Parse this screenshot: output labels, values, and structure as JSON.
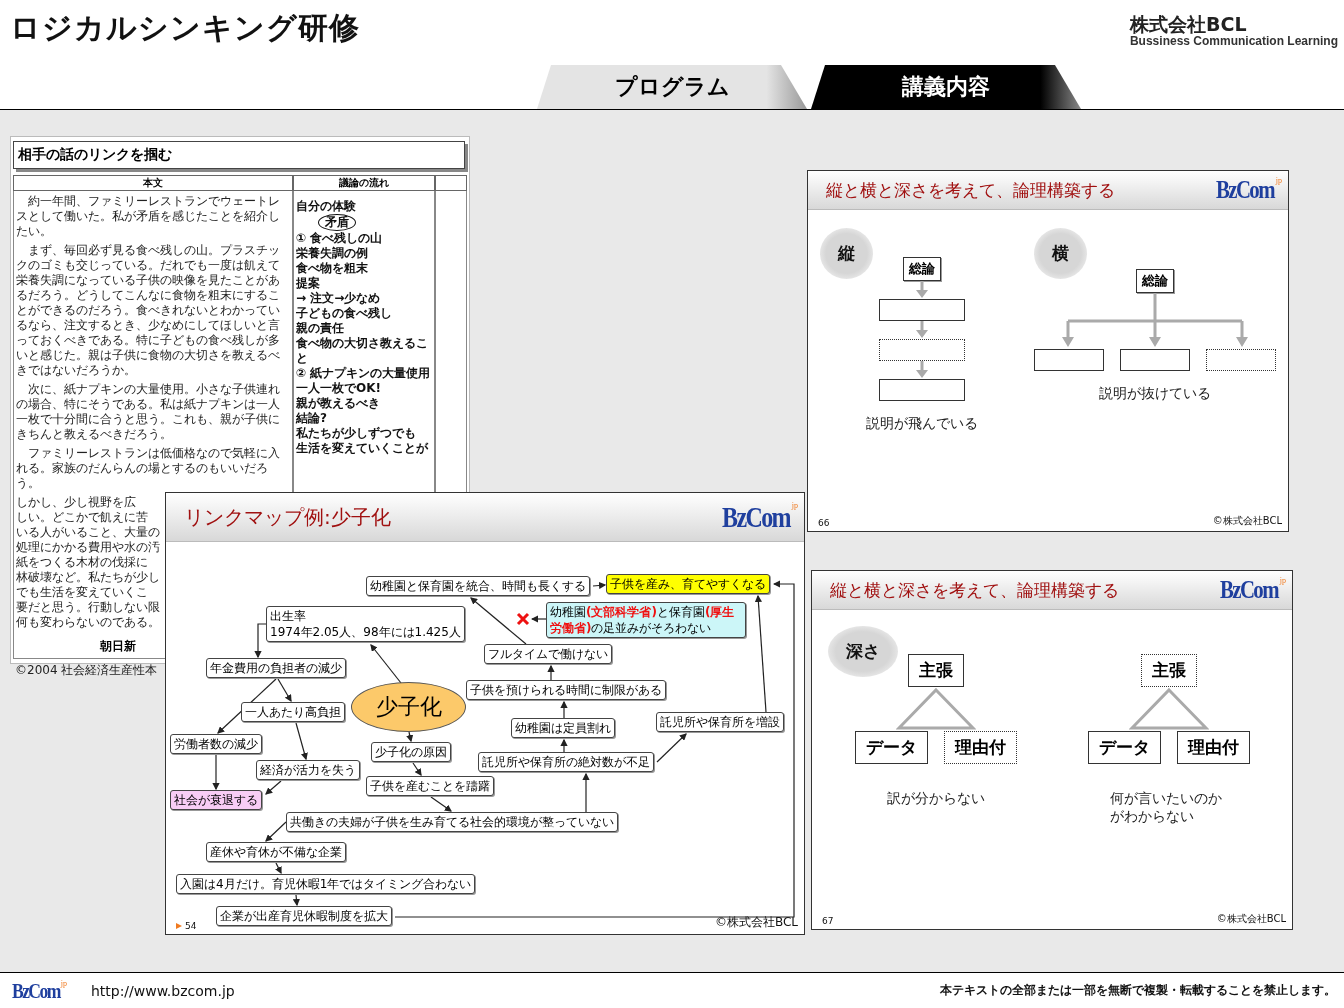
{
  "header": {
    "title": "ロジカルシンキング研修",
    "company": "株式会社BCL",
    "company_tagline": "Bussiness Communication Learning"
  },
  "tabs": [
    {
      "label": "プログラム",
      "selected": false
    },
    {
      "label": "講義内容",
      "selected": true
    }
  ],
  "document": {
    "title": "相手の話のリンクを掴む",
    "columns": [
      "本文",
      "議論の流れ"
    ],
    "body": [
      "約一年間、ファミリーレストランでウェートレスとして働いた。私が矛盾を感じたことを紹介したい。",
      "まず、毎回必ず見る食べ残しの山。プラスチックのゴミも交じっている。だれでも一度は飢えて栄養失調になっている子供の映像を見たことがあるだろう。どうしてこんなに食物を粗末にすることができるのだろう。食べきれないとわかっているなら、注文するとき、少なめにしてほしいと言っておくべきである。特に子どもの食べ残しが多いと感じた。親は子供に食物の大切さを教えるべきではないだろうか。",
      "次に、紙ナプキンの大量使用。小さな子供連れの場合、特にそうである。私は紙ナプキンは一人一枚で十分間に合うと思う。これも、親が子供にきちんと教えるべきだろう。",
      "ファミリーレストランは低価格なので気軽に入れる。家族のだんらんの場とするのもいいだろう。"
    ],
    "cut_lines": [
      "しかし、少し視野を広",
      "しい。どこかで飢えに苦",
      "いる人がいること、大量の",
      "処理にかかる費用や水の汚",
      "紙をつくる木材の伐採に",
      "林破壊など。私たちが少し",
      "でも生活を変えていくこ",
      "要だと思う。行動しない限",
      "何も変わらないのである。"
    ],
    "source": "朝日新",
    "notes": [
      {
        "text": "自分の体験",
        "kind": "plain"
      },
      {
        "text": "矛盾",
        "kind": "circled"
      },
      {
        "text": "① 食べ残しの山",
        "kind": "plain"
      },
      {
        "text": "栄養失調の例",
        "kind": "plain"
      },
      {
        "text": "食べ物を粗末",
        "kind": "plain"
      },
      {
        "text": "提案",
        "kind": "plain"
      },
      {
        "text": "→ 注文→少なめ",
        "kind": "plain"
      },
      {
        "text": "子どもの食べ残し",
        "kind": "plain"
      },
      {
        "text": "親の責任",
        "kind": "plain"
      },
      {
        "text": "食べ物の大切さ教えること",
        "kind": "plain"
      },
      {
        "text": "② 紙ナプキンの大量使用",
        "kind": "plain"
      },
      {
        "text": "一人一枚でOK!",
        "kind": "plain"
      },
      {
        "text": "親が教えるべき",
        "kind": "plain"
      },
      {
        "text": "結論?",
        "kind": "plain"
      },
      {
        "text": "私たちが少しずつでも",
        "kind": "plain"
      },
      {
        "text": "生活を変えていくことが",
        "kind": "plain"
      }
    ],
    "footer": "©2004 社会経済生産性本"
  },
  "link_map": {
    "title": "リンクマップ例:少子化",
    "logo": "BzCom",
    "logo_suffix": "jp",
    "page": "54",
    "copyright": "©株式会社BCL",
    "nodes": [
      {
        "text": "幼稚園と保育園を統合、時間も長くする",
        "kind": "box",
        "color": "#ffffff"
      },
      {
        "text": "子供を産み、育てやすくなる",
        "kind": "box",
        "color": "#ffff00"
      },
      {
        "text": "幼稚園**(文部科学省)**と保育園**(厚生労働省)**の足並みがそろわない",
        "kind": "box",
        "color": "#ccf6f8"
      },
      {
        "kind": "cross"
      },
      {
        "text": "フルタイムで働けない",
        "kind": "box",
        "color": "#ffffff"
      },
      {
        "text": "子供を預けられる時間に制限がある",
        "kind": "box",
        "color": "#ffffff"
      },
      {
        "text": "託児所や保育所を増設",
        "kind": "box",
        "color": "#ffffff"
      },
      {
        "text": "幼稚園は定員割れ",
        "kind": "box",
        "color": "#ffffff"
      },
      {
        "text": "託児所や保育所の絶対数が不足",
        "kind": "box",
        "color": "#ffffff"
      },
      {
        "heading": "出生率",
        "text": "1974年2.05人、98年には1.425人",
        "kind": "titled",
        "color": "#ffffff"
      },
      {
        "text": "少子化",
        "kind": "ellipse",
        "color": "#fcc96a"
      },
      {
        "text": "年金費用の負担者の減少",
        "kind": "box",
        "color": "#ffffff"
      },
      {
        "text": "一人あたり高負担",
        "kind": "box",
        "color": "#ffffff"
      },
      {
        "text": "労働者数の減少",
        "kind": "box",
        "color": "#ffffff"
      },
      {
        "text": "経済が活力を失う",
        "kind": "box",
        "color": "#ffffff"
      },
      {
        "text": "社会が衰退する",
        "kind": "box",
        "color": "#f8cdf5"
      },
      {
        "text": "少子化の原因",
        "kind": "box",
        "color": "#ffffff"
      },
      {
        "text": "子供を産むことを躊躇",
        "kind": "box",
        "color": "#ffffff"
      },
      {
        "text": "共働きの夫婦が子供を生み育てる社会的環境が整っていない",
        "kind": "box",
        "color": "#ffffff"
      },
      {
        "text": "産休や育休が不備な企業",
        "kind": "box",
        "color": "#ffffff"
      },
      {
        "text": "入園は4月だけ。育児休暇1年ではタイミング合わない",
        "kind": "box",
        "color": "#ffffff"
      },
      {
        "text": "企業が出産育児休暇制度を拡大",
        "kind": "box",
        "color": "#ffffff"
      }
    ]
  },
  "slides": [
    {
      "title": "縦と横と深さを考えて、論理構築する",
      "logo": "BzCom",
      "logo_suffix": "jp",
      "page": "66",
      "copyright": "©株式会社BCL",
      "panels": [
        {
          "kind": "chain",
          "label": "縦",
          "top": "総論",
          "boxes": [
            {
              "dashed": false
            },
            {
              "dashed": true
            },
            {
              "dashed": false
            }
          ],
          "caption": "説明が飛んでいる"
        },
        {
          "kind": "tree",
          "label": "横",
          "top": "総論",
          "boxes": [
            {
              "dashed": false
            },
            {
              "dashed": false
            },
            {
              "dashed": true
            }
          ],
          "caption": "説明が抜けている"
        }
      ]
    },
    {
      "title": "縦と横と深さを考えて、論理構築する",
      "logo": "BzCom",
      "logo_suffix": "jp",
      "page": "67",
      "copyright": "©株式会社BCL",
      "label": "深さ",
      "panels": [
        {
          "kind": "pyramid",
          "claim": {
            "text": "主張",
            "dashed": false
          },
          "parts": [
            {
              "text": "データ",
              "dashed": false
            },
            {
              "text": "理由付",
              "dashed": true
            }
          ],
          "caption": "訳が分からない"
        },
        {
          "kind": "pyramid",
          "claim": {
            "text": "主張",
            "dashed": true
          },
          "parts": [
            {
              "text": "データ",
              "dashed": false
            },
            {
              "text": "理由付",
              "dashed": false
            }
          ],
          "caption": "何が言いたいのかがわからない"
        }
      ]
    }
  ],
  "footer": {
    "logo": "BzCom",
    "logo_suffix": "jp",
    "url": "http://www.bzcom.jp",
    "notice": "本テキストの全部または一部を無断で複製・転載することを禁止します。"
  }
}
